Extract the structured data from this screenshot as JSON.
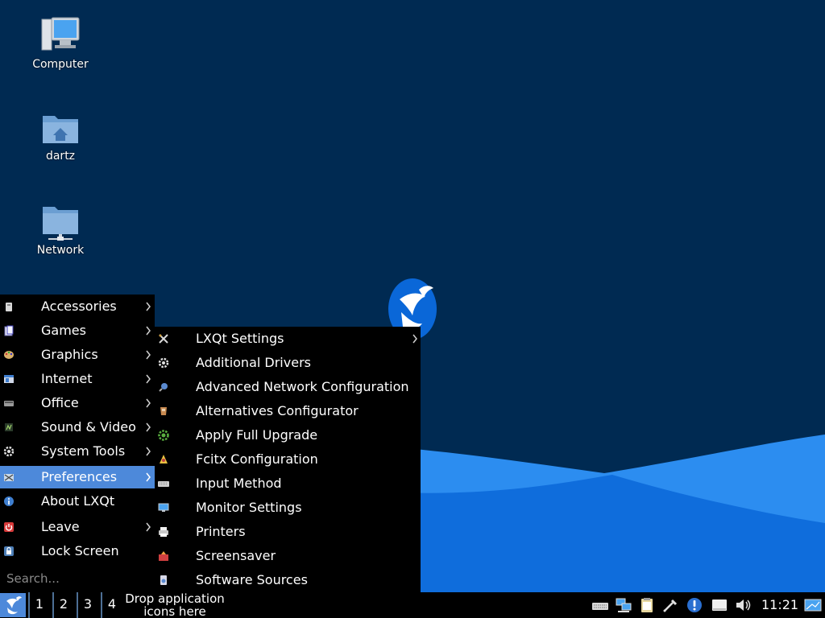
{
  "desktop": {
    "icons": [
      {
        "label": "Computer",
        "icon": "computer-icon"
      },
      {
        "label": "dartz",
        "icon": "home-folder-icon"
      },
      {
        "label": "Network",
        "icon": "network-folder-icon"
      }
    ]
  },
  "main_menu": {
    "items": [
      {
        "label": "Accessories",
        "icon": "accessories-icon",
        "has_submenu": true
      },
      {
        "label": "Games",
        "icon": "games-icon",
        "has_submenu": true
      },
      {
        "label": "Graphics",
        "icon": "graphics-icon",
        "has_submenu": true
      },
      {
        "label": "Internet",
        "icon": "internet-icon",
        "has_submenu": true
      },
      {
        "label": "Office",
        "icon": "office-icon",
        "has_submenu": true
      },
      {
        "label": "Sound & Video",
        "icon": "sound-video-icon",
        "has_submenu": true
      },
      {
        "label": "System Tools",
        "icon": "system-tools-icon",
        "has_submenu": true
      },
      {
        "label": "Preferences",
        "icon": "preferences-icon",
        "has_submenu": true,
        "active": true
      },
      {
        "label": "About LXQt",
        "icon": "about-icon",
        "has_submenu": false
      },
      {
        "label": "Leave",
        "icon": "power-icon",
        "has_submenu": true
      },
      {
        "label": "Lock Screen",
        "icon": "lock-icon",
        "has_submenu": false
      }
    ],
    "search_placeholder": "Search..."
  },
  "sub_menu": {
    "items": [
      {
        "label": "LXQt Settings",
        "icon": "settings-tools-icon",
        "has_submenu": true
      },
      {
        "label": "Additional Drivers",
        "icon": "gear-icon"
      },
      {
        "label": "Advanced Network Configuration",
        "icon": "network-config-icon"
      },
      {
        "label": "Alternatives Configurator",
        "icon": "alternatives-icon"
      },
      {
        "label": "Apply Full Upgrade",
        "icon": "upgrade-icon"
      },
      {
        "label": "Fcitx Configuration",
        "icon": "fcitx-icon"
      },
      {
        "label": "Input Method",
        "icon": "keyboard-icon"
      },
      {
        "label": "Monitor Settings",
        "icon": "monitor-icon"
      },
      {
        "label": "Printers",
        "icon": "printer-icon"
      },
      {
        "label": "Screensaver",
        "icon": "screensaver-icon"
      },
      {
        "label": "Software Sources",
        "icon": "software-sources-icon"
      }
    ]
  },
  "panel": {
    "desktops": [
      "1",
      "2",
      "3",
      "4"
    ],
    "quicklaunch_text": "Drop application icons here",
    "tray_icons": [
      "keyboard-layout-icon",
      "network-status-icon",
      "clipboard-icon",
      "eyedropper-icon",
      "update-notifier-icon",
      "removable-media-icon",
      "volume-icon"
    ],
    "clock": "11:21",
    "show_desktop_icon": "show-desktop-icon"
  },
  "colors": {
    "desktop_bg": "#002a52",
    "wave_light": "#2c8df0",
    "wave_dark": "#0a67d8",
    "menu_bg": "#000000",
    "highlight": "#4d89da"
  }
}
